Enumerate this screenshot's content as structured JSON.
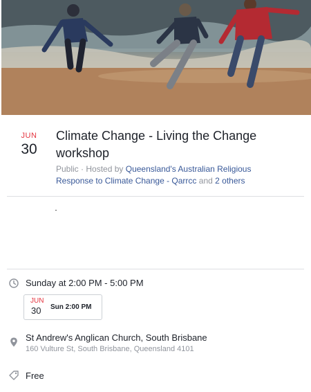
{
  "event": {
    "cover_alt": "People jumping on a beach",
    "date": {
      "month": "JUN",
      "day": "30"
    },
    "title": "Climate Change - Living the Change workshop",
    "privacy": "Public",
    "hosted_prefix": "Hosted by",
    "host_name": "Queensland's Australian Religious Response to Climate Change - Qarrcc",
    "hosted_and": "and",
    "others": "2 others"
  },
  "details": {
    "time_text": "Sunday at 2:00 PM - 5:00 PM",
    "mini_cal": {
      "month": "JUN",
      "day": "30",
      "time": "Sun  2:00 PM"
    },
    "location_name": "St Andrew's Anglican Church, South Brisbane",
    "location_address": "160 Vulture St, South Brisbane, Queensland 4101",
    "price": "Free"
  },
  "icons": {
    "time": "clock-icon",
    "location": "location-pin-icon",
    "price": "tag-icon"
  },
  "colors": {
    "accent_red": "#e4333e",
    "link_blue": "#385898",
    "muted": "#90949c"
  }
}
